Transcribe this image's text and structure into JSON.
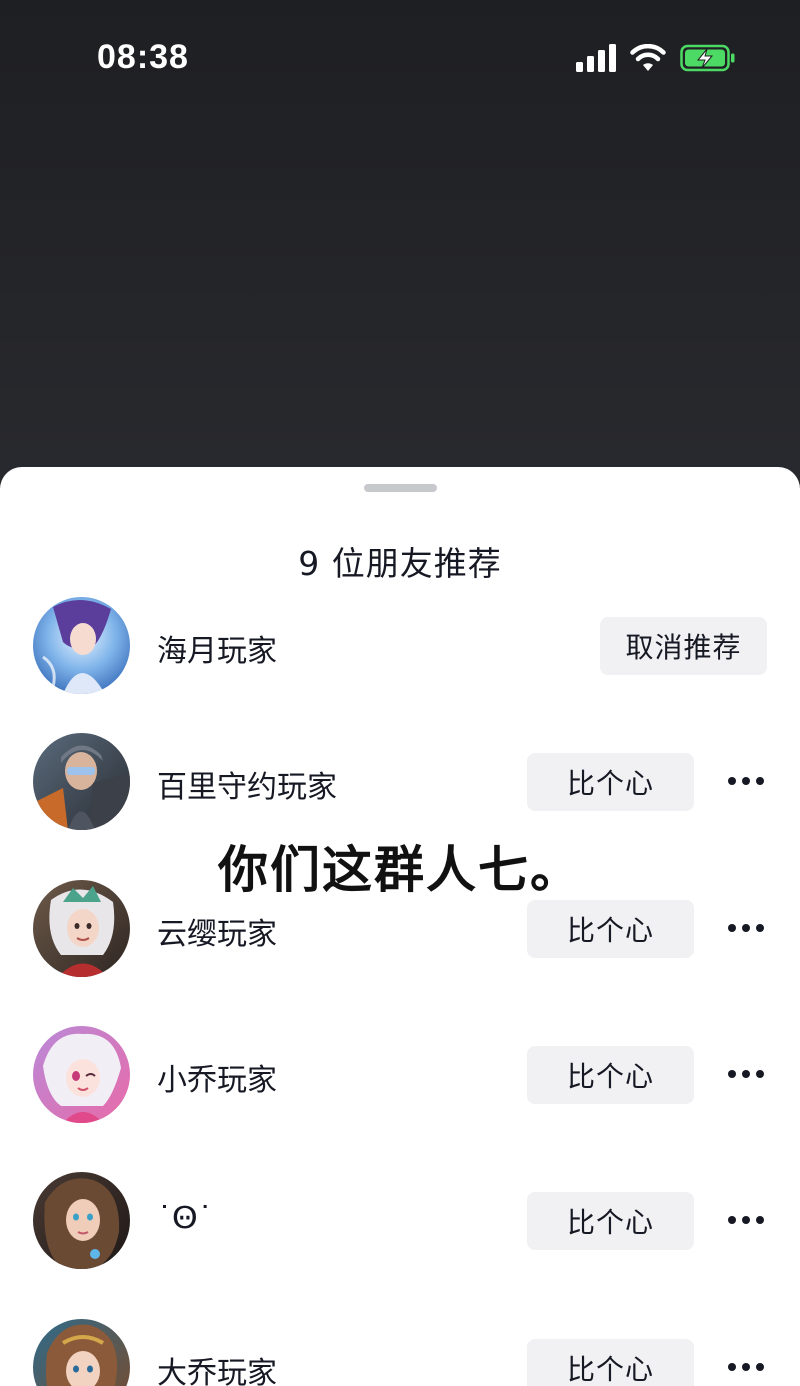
{
  "status_bar": {
    "time": "08:38",
    "icons": [
      "signal-icon",
      "wifi-icon",
      "battery-charging-icon"
    ]
  },
  "sheet": {
    "title": "9 位朋友推荐",
    "rows": [
      {
        "name": "海月玩家",
        "action": "取消推荐",
        "avatar": "avatar-haiyue",
        "has_more": false
      },
      {
        "name": "百里守约玩家",
        "action": "比个心",
        "avatar": "avatar-bailishouyue",
        "has_more": true
      },
      {
        "name": "云缨玩家",
        "action": "比个心",
        "avatar": "avatar-yunying",
        "has_more": true
      },
      {
        "name": "小乔玩家",
        "action": "比个心",
        "avatar": "avatar-xiaoqiao",
        "has_more": true
      },
      {
        "name": "˙Ꙫ˙",
        "action": "比个心",
        "avatar": "avatar-user",
        "has_more": true
      },
      {
        "name": "大乔玩家",
        "action": "比个心",
        "avatar": "avatar-daqiao",
        "has_more": true
      }
    ]
  },
  "overlay_caption": "你们这群人七。",
  "colors": {
    "background_top": "#1e1f22",
    "sheet": "#ffffff",
    "button": "#f1f1f3",
    "text": "#161823",
    "battery": "#4cd964"
  }
}
